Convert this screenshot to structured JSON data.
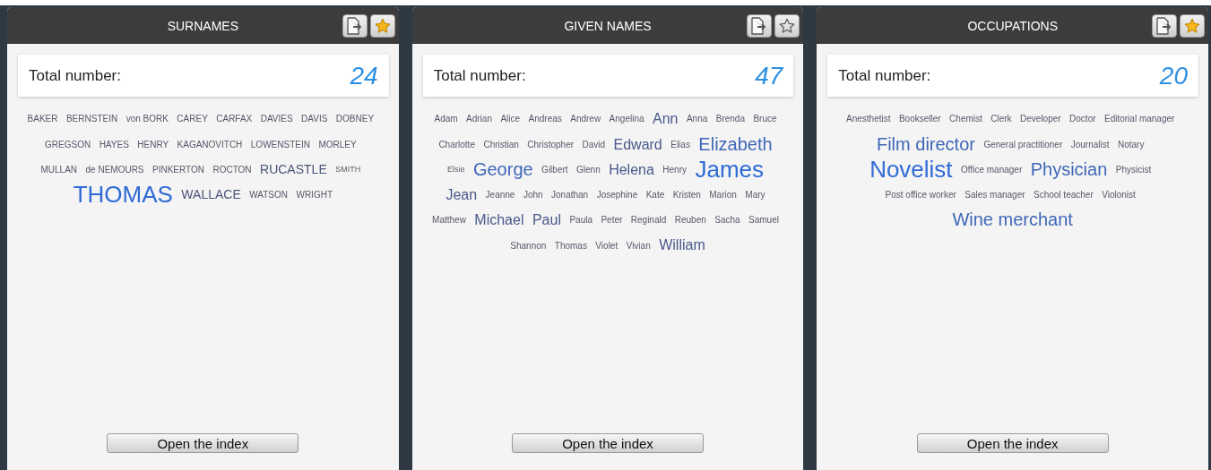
{
  "panels": [
    {
      "title": "SURNAMES",
      "favorite": true,
      "total_label": "Total number:",
      "total": "24",
      "button": "Open the index",
      "words": [
        {
          "text": "BAKER",
          "kind": "s"
        },
        {
          "text": "BERNSTEIN",
          "kind": "s"
        },
        {
          "text": "von BORK",
          "kind": "s"
        },
        {
          "text": "CAREY",
          "kind": "s"
        },
        {
          "text": "CARFAX",
          "kind": "s"
        },
        {
          "text": "DAVIES",
          "kind": "s"
        },
        {
          "text": "DAVIS",
          "kind": "s"
        },
        {
          "text": "DOBNEY",
          "kind": "s"
        },
        {
          "text": "GREGSON",
          "kind": "s"
        },
        {
          "text": "HAYES",
          "kind": "s"
        },
        {
          "text": "HENRY",
          "kind": "s"
        },
        {
          "text": "KAGANOVITCH",
          "kind": "s"
        },
        {
          "text": "LOWENSTEIN",
          "kind": "s"
        },
        {
          "text": "MORLEY",
          "kind": "s"
        },
        {
          "text": "MULLAN",
          "kind": "s"
        },
        {
          "text": "de NEMOURS",
          "kind": "s"
        },
        {
          "text": "PINKERTON",
          "kind": "s"
        },
        {
          "text": "ROCTON",
          "kind": "s"
        },
        {
          "text": "RUCASTLE",
          "kind": "m"
        },
        {
          "text": "SMITH",
          "kind": "xs"
        },
        {
          "text": "THOMAS",
          "kind": "xxl"
        },
        {
          "text": "WALLACE",
          "kind": "m"
        },
        {
          "text": "WATSON",
          "kind": "s"
        },
        {
          "text": "WRIGHT",
          "kind": "s"
        }
      ]
    },
    {
      "title": "GIVEN NAMES",
      "favorite": false,
      "total_label": "Total number:",
      "total": "47",
      "button": "Open the index",
      "words": [
        {
          "text": "Adam",
          "kind": "s"
        },
        {
          "text": "Adrian",
          "kind": "s"
        },
        {
          "text": "Alice",
          "kind": "s"
        },
        {
          "text": "Andreas",
          "kind": "s"
        },
        {
          "text": "Andrew",
          "kind": "s"
        },
        {
          "text": "Angelina",
          "kind": "s"
        },
        {
          "text": "Ann",
          "kind": "l"
        },
        {
          "text": "Anna",
          "kind": "s"
        },
        {
          "text": "Brenda",
          "kind": "s"
        },
        {
          "text": "Bruce",
          "kind": "s"
        },
        {
          "text": "Charlotte",
          "kind": "s"
        },
        {
          "text": "Christian",
          "kind": "s"
        },
        {
          "text": "Christopher",
          "kind": "s"
        },
        {
          "text": "David",
          "kind": "s"
        },
        {
          "text": "Edward",
          "kind": "l"
        },
        {
          "text": "Elias",
          "kind": "s"
        },
        {
          "text": "Elizabeth",
          "kind": "xl"
        },
        {
          "text": "Elsie",
          "kind": "xs"
        },
        {
          "text": "George",
          "kind": "xl"
        },
        {
          "text": "Gilbert",
          "kind": "s"
        },
        {
          "text": "Glenn",
          "kind": "s"
        },
        {
          "text": "Helena",
          "kind": "l"
        },
        {
          "text": "Henry",
          "kind": "s"
        },
        {
          "text": "James",
          "kind": "xxl"
        },
        {
          "text": "Jean",
          "kind": "l"
        },
        {
          "text": "Jeanne",
          "kind": "s"
        },
        {
          "text": "John",
          "kind": "s"
        },
        {
          "text": "Jonathan",
          "kind": "s"
        },
        {
          "text": "Josephine",
          "kind": "s"
        },
        {
          "text": "Kate",
          "kind": "s"
        },
        {
          "text": "Kristen",
          "kind": "s"
        },
        {
          "text": "Marion",
          "kind": "s"
        },
        {
          "text": "Mary",
          "kind": "s"
        },
        {
          "text": "Matthew",
          "kind": "s"
        },
        {
          "text": "Michael",
          "kind": "l"
        },
        {
          "text": "Paul",
          "kind": "l"
        },
        {
          "text": "Paula",
          "kind": "s"
        },
        {
          "text": "Peter",
          "kind": "s"
        },
        {
          "text": "Reginald",
          "kind": "s"
        },
        {
          "text": "Reuben",
          "kind": "s"
        },
        {
          "text": "Sacha",
          "kind": "s"
        },
        {
          "text": "Samuel",
          "kind": "s"
        },
        {
          "text": "Shannon",
          "kind": "s"
        },
        {
          "text": "Thomas",
          "kind": "s"
        },
        {
          "text": "Violet",
          "kind": "s"
        },
        {
          "text": "Vivian",
          "kind": "s"
        },
        {
          "text": "William",
          "kind": "l"
        }
      ]
    },
    {
      "title": "OCCUPATIONS",
      "favorite": true,
      "total_label": "Total number:",
      "total": "20",
      "button": "Open the index",
      "words": [
        {
          "text": "Anesthetist",
          "kind": "s"
        },
        {
          "text": "Bookseller",
          "kind": "s"
        },
        {
          "text": "Chemist",
          "kind": "s"
        },
        {
          "text": "Clerk",
          "kind": "s"
        },
        {
          "text": "Developer",
          "kind": "s"
        },
        {
          "text": "Doctor",
          "kind": "s"
        },
        {
          "text": "Editorial manager",
          "kind": "s"
        },
        {
          "text": "Film director",
          "kind": "xl"
        },
        {
          "text": "General practitioner",
          "kind": "s"
        },
        {
          "text": "Journalist",
          "kind": "s"
        },
        {
          "text": "Notary",
          "kind": "s"
        },
        {
          "text": "Novelist",
          "kind": "xxl"
        },
        {
          "text": "Office manager",
          "kind": "s"
        },
        {
          "text": "Physician",
          "kind": "xl"
        },
        {
          "text": "Physicist",
          "kind": "s"
        },
        {
          "text": "Post office worker",
          "kind": "s"
        },
        {
          "text": "Sales manager",
          "kind": "s"
        },
        {
          "text": "School teacher",
          "kind": "s"
        },
        {
          "text": "Violonist",
          "kind": "s"
        },
        {
          "text": "Wine merchant",
          "kind": "xl"
        }
      ]
    }
  ]
}
